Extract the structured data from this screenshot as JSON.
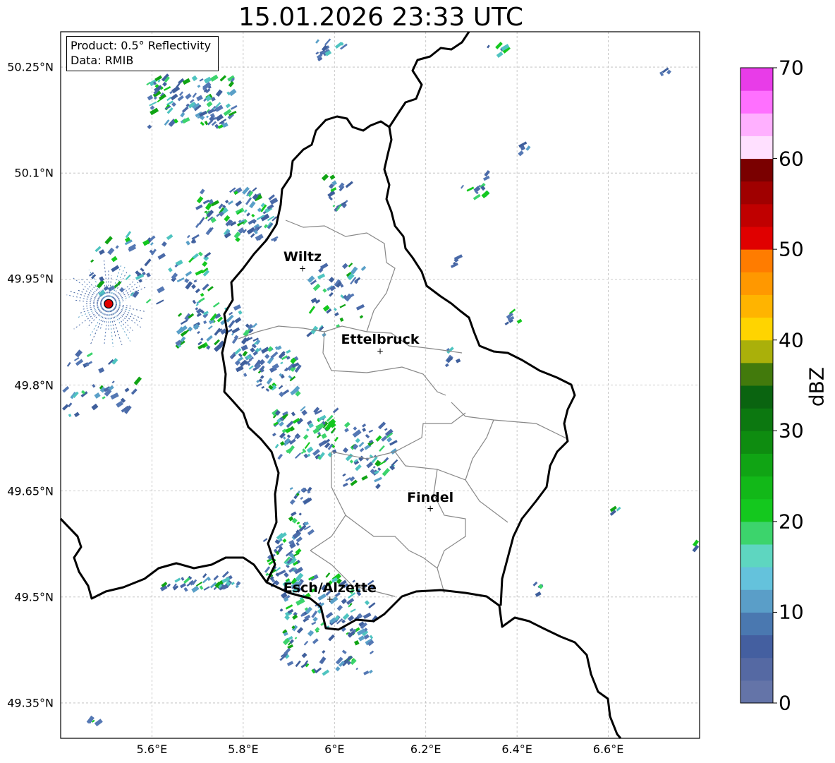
{
  "title": "15.01.2026 23:33 UTC",
  "info": {
    "product": "Product: 0.5° Reflectivity",
    "data": "Data: RMIB"
  },
  "map": {
    "lat_ticks": [
      "50.25°N",
      "50.1°N",
      "49.95°N",
      "49.8°N",
      "49.65°N",
      "49.5°N",
      "49.35°N"
    ],
    "lon_ticks": [
      "5.6°E",
      "5.8°E",
      "6°E",
      "6.2°E",
      "6.4°E",
      "6.6°E"
    ],
    "lat_values": [
      50.25,
      50.1,
      49.95,
      49.8,
      49.65,
      49.5,
      49.35
    ],
    "lon_values": [
      5.6,
      5.8,
      6.0,
      6.2,
      6.4,
      6.6
    ],
    "extent": {
      "lon_min": 5.4,
      "lon_max": 6.8,
      "lat_min": 49.3,
      "lat_max": 50.3
    },
    "gridlines": true,
    "radar_site": {
      "lon": 5.505,
      "lat": 49.915,
      "color": "#e00000"
    },
    "cities": [
      {
        "name": "Wiltz",
        "lon": 5.93,
        "lat": 49.965
      },
      {
        "name": "Ettelbruck",
        "lon": 6.1,
        "lat": 49.848
      },
      {
        "name": "Findel",
        "lon": 6.21,
        "lat": 49.625
      },
      {
        "name": "Esch/Alzette",
        "lon": 5.99,
        "lat": 49.497
      }
    ],
    "border_color": "#000000",
    "district_color": "#888888"
  },
  "colorbar": {
    "label": "dBZ",
    "min": 0,
    "max": 70,
    "step": 2.5,
    "ticks": [
      "0",
      "10",
      "20",
      "30",
      "40",
      "50",
      "60",
      "70"
    ],
    "tick_values": [
      0,
      10,
      20,
      30,
      40,
      50,
      60,
      70
    ],
    "colors": [
      "#6474a8",
      "#5569a3",
      "#445fa0",
      "#4a78b0",
      "#5a9ec8",
      "#64c2dc",
      "#5ed6c0",
      "#3cd46c",
      "#14c81e",
      "#12b818",
      "#10a414",
      "#0e8c10",
      "#0c7810",
      "#0a6410",
      "#427a0c",
      "#aab00a",
      "#ffd400",
      "#ffb400",
      "#ff9800",
      "#ff7c00",
      "#e00000",
      "#c00000",
      "#a00000",
      "#7a0000",
      "#ffe0ff",
      "#ffb0ff",
      "#ff70ff",
      "#e83ce8"
    ]
  },
  "echo_palette": [
    "#4a6aa8",
    "#5578b4",
    "#3f5f9c",
    "#5aa0c8",
    "#4fc4c0",
    "#3cd46c",
    "#14c81e",
    "#10a414"
  ]
}
